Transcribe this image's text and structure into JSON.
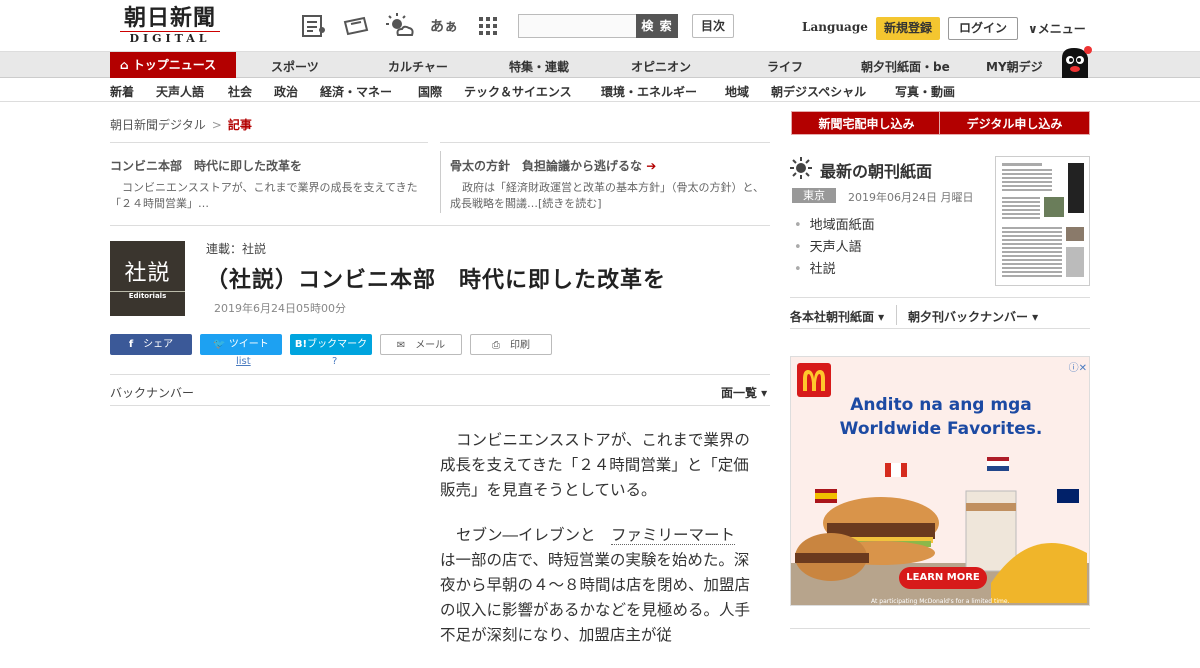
{
  "header": {
    "logo_main": "朝日新聞",
    "logo_sub": "DIGITAL",
    "search_placeholder": "",
    "search_button": "検 索",
    "toc_button": "目次",
    "language": "Language",
    "register": "新規登録",
    "login": "ログイン",
    "menu": "∨メニュー",
    "font_size_icon_text": "あぁ"
  },
  "nav_primary": {
    "top_news": "トップニュース",
    "items": [
      "スポーツ",
      "カルチャー",
      "特集・連載",
      "オピニオン",
      "ライフ",
      "朝夕刊紙面・be",
      "MY朝デジ"
    ]
  },
  "nav_secondary": {
    "items": [
      "新着",
      "天声人語",
      "社会",
      "政治",
      "経済・マネー",
      "国際",
      "テック＆サイエンス",
      "環境・エネルギー",
      "地域",
      "朝デジスペシャル",
      "写真・動画"
    ]
  },
  "breadcrumb": {
    "home": "朝日新聞デジタル",
    "sep": ">",
    "current": "記事"
  },
  "related": [
    {
      "title": "コンビニ本部　時代に即した改革を",
      "desc": "コンビニエンスストアが、これまで業界の成長を支えてきた「２４時間営業」…"
    },
    {
      "title": "骨太の方針　負担論議から逃げるな",
      "desc": "政府は「経済財政運営と改革の基本方針」（骨太の方針）と、成長戦略を閣議…[続きを読む]"
    }
  ],
  "article": {
    "logo_main": "社説",
    "logo_sub": "Editorials",
    "series": "連載：社説",
    "title": "（社説）コンビニ本部　時代に即した改革を",
    "date": "2019年6月24日05時00分",
    "share": {
      "facebook": "シェア",
      "twitter": "ツイート",
      "hatena": "ブックマーク",
      "mail": "メール",
      "print": "印刷",
      "twitter_sub": "list",
      "hatena_sub": "?"
    },
    "backnumber": "バックナンバー",
    "page_list": "面一覧 ▾",
    "p1": "コンビニエンスストアが、これまで業界の成長を支えてきた「２４時間営業」と「定価販売」を見直そうとしている。",
    "p2_pre": "セブン―イレブンと",
    "p2_link": "ファミリーマート",
    "p2_post": "は一部の店で、時短営業の実験を始めた。深夜から早朝の４～８時間は店を閉め、加盟店の収入に影響があるかなどを見極める。人手不足が深刻になり、加盟店主が従"
  },
  "sidebar": {
    "delivery_btn": "新聞宅配申し込み",
    "digital_btn": "デジタル申し込み",
    "morning_title": "最新の朝刊紙面",
    "city": "東京",
    "paper_date": "2019年06月24日 月曜日",
    "links": [
      "地域面紙面",
      "天声人語",
      "社説"
    ],
    "honsha": "各本社朝刊紙面 ▾",
    "yuban": "朝夕刊バックナンバー ▾"
  },
  "ad": {
    "headline": "Andito na ang mga\nWorldwide Favorites.",
    "cta": "LEARN MORE",
    "fine": "At participating McDonald's for a limited time.",
    "brand_color": "#d71a1a"
  },
  "colors": {
    "accent": "#b30000",
    "register": "#f4c630",
    "facebook": "#3b5998",
    "twitter": "#1da1f2",
    "hatena": "#00a4de"
  }
}
